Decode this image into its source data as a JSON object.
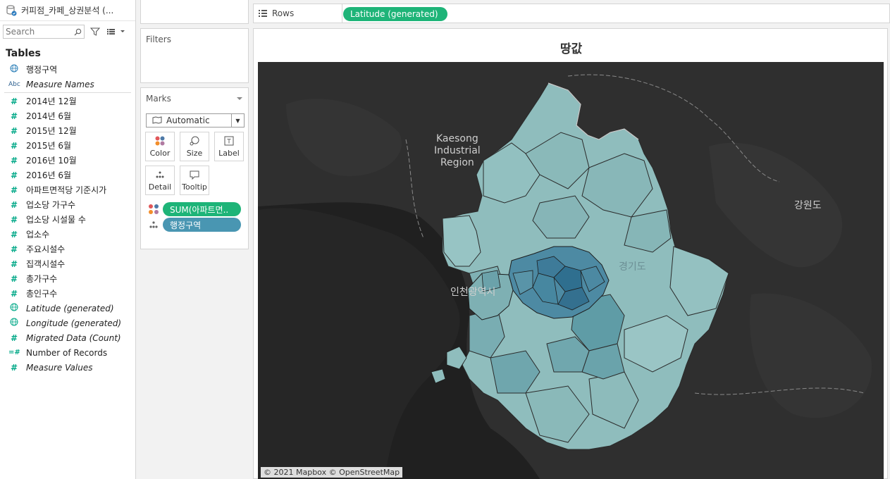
{
  "datasource": {
    "name": "커피점_카페_상권분석 (..."
  },
  "search": {
    "placeholder": "Search"
  },
  "tables_title": "Tables",
  "dimension_fields": [
    {
      "name": "행정구역",
      "type": "geo",
      "italic": false
    },
    {
      "name": "Measure Names",
      "type": "abc",
      "italic": true
    }
  ],
  "measure_fields": [
    {
      "name": "2014년 12월",
      "type": "measure",
      "italic": false
    },
    {
      "name": "2014년 6월",
      "type": "measure",
      "italic": false
    },
    {
      "name": "2015년 12월",
      "type": "measure",
      "italic": false
    },
    {
      "name": "2015년 6월",
      "type": "measure",
      "italic": false
    },
    {
      "name": "2016년 10월",
      "type": "measure",
      "italic": false
    },
    {
      "name": "2016년 6월",
      "type": "measure",
      "italic": false
    },
    {
      "name": "아파트면적당 기준시가",
      "type": "measure",
      "italic": false
    },
    {
      "name": "업소당 가구수",
      "type": "measure",
      "italic": false
    },
    {
      "name": "업소당 시설물 수",
      "type": "measure",
      "italic": false
    },
    {
      "name": "업소수",
      "type": "measure",
      "italic": false
    },
    {
      "name": "주요시설수",
      "type": "measure",
      "italic": false
    },
    {
      "name": "집객시설수",
      "type": "measure",
      "italic": false
    },
    {
      "name": "총가구수",
      "type": "measure",
      "italic": false
    },
    {
      "name": "총인구수",
      "type": "measure",
      "italic": false
    },
    {
      "name": "Latitude (generated)",
      "type": "geo",
      "italic": true
    },
    {
      "name": "Longitude (generated)",
      "type": "geo",
      "italic": true
    },
    {
      "name": "Migrated Data (Count)",
      "type": "measure",
      "italic": true
    },
    {
      "name": "Number of Records",
      "type": "measure-calc",
      "italic": false
    },
    {
      "name": "Measure Values",
      "type": "measure",
      "italic": true
    }
  ],
  "filters": {
    "title": "Filters"
  },
  "marks": {
    "title": "Marks",
    "mark_type": "Automatic",
    "buttons": {
      "color": "Color",
      "size": "Size",
      "label": "Label",
      "detail": "Detail",
      "tooltip": "Tooltip"
    },
    "pills": [
      {
        "name": "SUM(아파트면..",
        "kind": "color"
      },
      {
        "name": "행정구역",
        "kind": "detail"
      }
    ]
  },
  "rows": {
    "label": "Rows",
    "pill": "Latitude (generated)"
  },
  "viz": {
    "title": "땅값",
    "map_labels": {
      "kaesong": "Kaesong\nIndustrial\nRegion",
      "gangwon": "강원도",
      "incheon": "인천광역시",
      "gyeonggi": "경기도"
    },
    "attribution": "© 2021 Mapbox © OpenStreetMap"
  },
  "colors": {
    "accent_green": "#1eb478",
    "pill_blue": "#4996b2",
    "map_background": "#202020",
    "choropleth_light": "#8fbdbd",
    "choropleth_dark": "#2f6f8f"
  }
}
